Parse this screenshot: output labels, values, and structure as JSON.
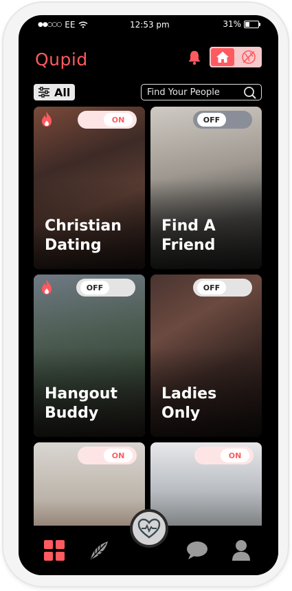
{
  "status": {
    "carrier": "EE",
    "time": "12:53 pm",
    "battery": "31%",
    "battery_level": 0.31
  },
  "app": {
    "name": "Qupid"
  },
  "filter": {
    "label": "All"
  },
  "search": {
    "placeholder": "Find Your People"
  },
  "cards": [
    {
      "title": "Christian\nDating",
      "toggle": "ON",
      "selected": true,
      "hot": true
    },
    {
      "title": "Find A\nFriend",
      "toggle": "OFF",
      "selected": false,
      "hot": false
    },
    {
      "title": "Hangout\nBuddy",
      "toggle": "OFF",
      "selected": true,
      "hot": true
    },
    {
      "title": "Ladies\nOnly",
      "toggle": "OFF",
      "selected": false,
      "hot": false
    },
    {
      "title": "",
      "toggle": "ON",
      "selected": false,
      "hot": false
    },
    {
      "title": "",
      "toggle": "ON",
      "selected": false,
      "hot": false
    }
  ],
  "colors": {
    "accent": "#ff5a5f",
    "accent_light": "#f6c9cb",
    "background": "#000000"
  },
  "icons": {
    "bell": "bell-icon",
    "home": "home-icon",
    "globe": "globe-icon",
    "filter": "sliders-icon",
    "search": "search-icon",
    "tab_grid": "grid-icon",
    "tab_leaf": "leaf-icon",
    "tab_center": "heart-pulse-icon",
    "tab_chat": "chat-icon",
    "tab_profile": "profile-icon"
  }
}
